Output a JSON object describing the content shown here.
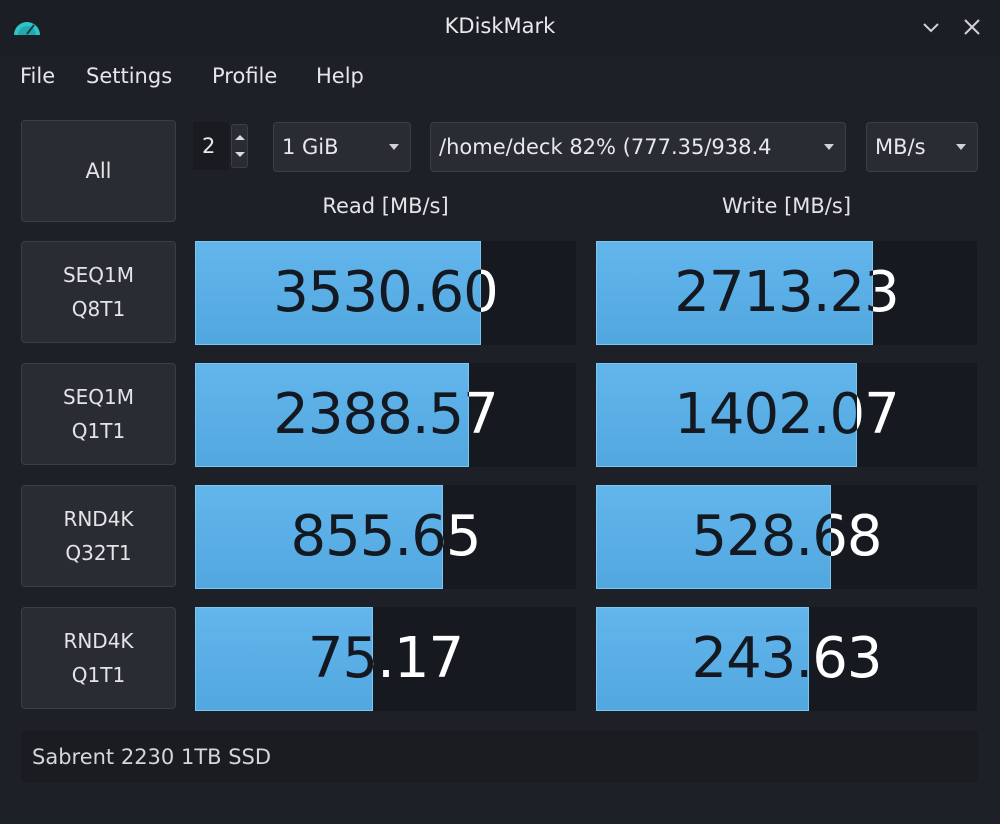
{
  "window": {
    "title": "KDiskMark",
    "icon": "kdiskmark-gauge-icon",
    "controls": [
      "minimize-chevron-icon",
      "close-icon"
    ]
  },
  "menu": [
    "File",
    "Settings",
    "Profile",
    "Help"
  ],
  "toolbar": {
    "all_label": "All",
    "loops": "2",
    "file_size": "1 GiB",
    "directory": "/home/deck 82% (777.35/938.4",
    "unit": "MB/s"
  },
  "columns": {
    "read": "Read [MB/s]",
    "write": "Write [MB/s]"
  },
  "accent": "#5aaee6",
  "tests": [
    {
      "line1": "SEQ1M",
      "line2": "Q8T1",
      "read": "3530.60",
      "read_fill": 0.75,
      "write": "2713.23",
      "write_fill": 0.726
    },
    {
      "line1": "SEQ1M",
      "line2": "Q1T1",
      "read": "2388.57",
      "read_fill": 0.718,
      "write": "1402.07",
      "write_fill": 0.686
    },
    {
      "line1": "RND4K",
      "line2": "Q32T1",
      "read": "855.65",
      "read_fill": 0.65,
      "write": "528.68",
      "write_fill": 0.616
    },
    {
      "line1": "RND4K",
      "line2": "Q1T1",
      "read": "75.17",
      "read_fill": 0.466,
      "write": "243.63",
      "write_fill": 0.558
    }
  ],
  "device": "Sabrent 2230 1TB SSD"
}
